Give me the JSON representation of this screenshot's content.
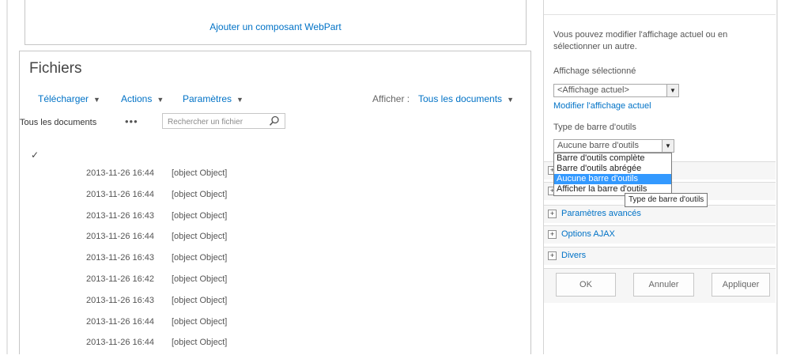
{
  "webpart_zone": {
    "add_label": "Ajouter un composant WebPart"
  },
  "files": {
    "title": "Fichiers",
    "toolbar": {
      "download": "Télécharger",
      "actions": "Actions",
      "settings": "Paramètres",
      "view_label": "Afficher :",
      "view_value": "Tous les documents"
    },
    "views": {
      "current": "Tous les documents",
      "more": "•••",
      "search_placeholder": "Rechercher un fichier"
    },
    "check_mark": "✓",
    "rows": [
      {
        "date": "2013-11-26 16:44",
        "name": "[object Object]"
      },
      {
        "date": "2013-11-26 16:44",
        "name": "[object Object]"
      },
      {
        "date": "2013-11-26 16:43",
        "name": "[object Object]"
      },
      {
        "date": "2013-11-26 16:44",
        "name": "[object Object]"
      },
      {
        "date": "2013-11-26 16:43",
        "name": "[object Object]"
      },
      {
        "date": "2013-11-26 16:42",
        "name": "[object Object]"
      },
      {
        "date": "2013-11-26 16:43",
        "name": "[object Object]"
      },
      {
        "date": "2013-11-26 16:44",
        "name": "[object Object]"
      },
      {
        "date": "2013-11-26 16:44",
        "name": "[object Object]"
      }
    ]
  },
  "tool_pane": {
    "intro_line1": "Vous pouvez modifier l'affichage actuel ou en",
    "intro_line2": "sélectionner un autre.",
    "selected_view_label": "Affichage sélectionné",
    "selected_view_value": "<Affichage actuel>",
    "edit_view_link": "Modifier l'affichage actuel",
    "toolbar_type_label": "Type de barre d'outils",
    "toolbar_type_value": "Aucune barre d'outils",
    "toolbar_type_options": [
      "Barre d'outils complète",
      "Barre d'outils abrégée",
      "Aucune barre d'outils",
      "Afficher la barre d'outils"
    ],
    "toolbar_type_selected_index": 2,
    "tooltip": "Type de barre d'outils",
    "sections": [
      "Paramètres avancés",
      "Options AJAX",
      "Divers"
    ],
    "buttons": {
      "ok": "OK",
      "cancel": "Annuler",
      "apply": "Appliquer"
    }
  },
  "colors": {
    "link": "#0072c6",
    "selection": "#3399ff"
  }
}
